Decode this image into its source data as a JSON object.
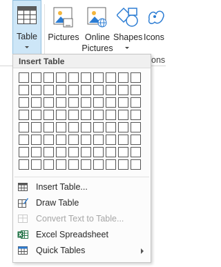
{
  "ribbon": {
    "table": {
      "label": "Table",
      "icon": "table-icon"
    },
    "pictures": {
      "label": "Pictures",
      "icon": "pictures-icon"
    },
    "online_pictures": {
      "label_line1": "Online",
      "label_line2": "Pictures",
      "icon": "online-pictures-icon"
    },
    "shapes": {
      "label": "Shapes",
      "icon": "shapes-icon"
    },
    "icons": {
      "label": "Icons",
      "icon": "icons-icon"
    },
    "group_label_partial": "ons"
  },
  "menu": {
    "header": "Insert Table",
    "grid": {
      "columns": 10,
      "rows": 8
    },
    "items": [
      {
        "label": "Insert Table...",
        "icon": "insert-table-icon",
        "enabled": true
      },
      {
        "label": "Draw Table",
        "icon": "draw-table-icon",
        "enabled": true
      },
      {
        "label": "Convert Text to Table...",
        "icon": "convert-text-icon",
        "enabled": false
      },
      {
        "label": "Excel Spreadsheet",
        "icon": "excel-icon",
        "enabled": true
      },
      {
        "label": "Quick Tables",
        "icon": "quick-tables-icon",
        "enabled": true,
        "submenu": true
      }
    ]
  },
  "colors": {
    "accent_blue": "#2b7cd3",
    "hover_fill": "#cde6f7",
    "excel_green": "#217346"
  }
}
